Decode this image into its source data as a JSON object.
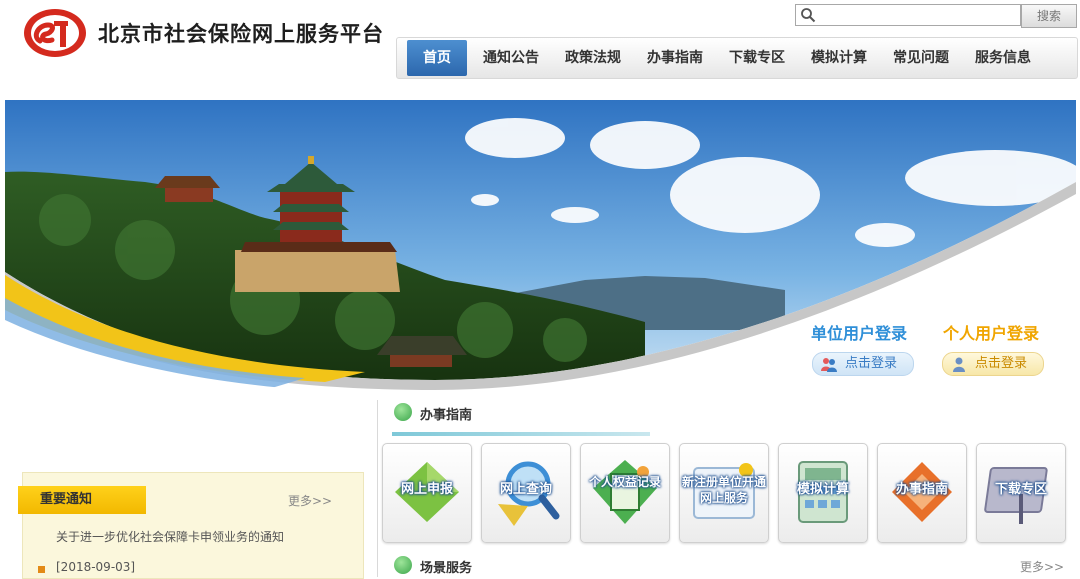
{
  "header": {
    "site_title": "北京市社会保险网上服务平台",
    "search": {
      "placeholder": "",
      "button_label": "搜索"
    }
  },
  "nav": {
    "items": [
      {
        "label": "首页",
        "active": true
      },
      {
        "label": "通知公告"
      },
      {
        "label": "政策法规"
      },
      {
        "label": "办事指南"
      },
      {
        "label": "下载专区"
      },
      {
        "label": "模拟计算"
      },
      {
        "label": "常见问题"
      },
      {
        "label": "服务信息"
      }
    ]
  },
  "banner": {
    "unit_login": {
      "title": "单位用户登录",
      "button_label": "点击登录"
    },
    "person_login": {
      "title": "个人用户登录",
      "button_label": "点击登录"
    }
  },
  "notice": {
    "tab_label": "重要通知",
    "more_label": "更多>>",
    "items": [
      {
        "title": "关于进一步优化社会保障卡申领业务的通知",
        "date": "[2018-09-03]"
      }
    ]
  },
  "guide": {
    "title": "办事指南",
    "tiles": [
      {
        "label": "网上申报",
        "icon": "declare-icon",
        "color": "#7cc242"
      },
      {
        "label": "网上查询",
        "icon": "magnifier-icon",
        "color": "#3d8fd6"
      },
      {
        "label": "个人权益记录",
        "icon": "record-icon",
        "color": "#4caf50"
      },
      {
        "label": "新注册单位开通网上服务",
        "icon": "register-icon",
        "color": "#2b7fd1"
      },
      {
        "label": "模拟计算",
        "icon": "calculator-icon",
        "color": "#6fa8d8"
      },
      {
        "label": "办事指南",
        "icon": "guide-icon",
        "color": "#e8702a"
      },
      {
        "label": "下载专区",
        "icon": "download-icon",
        "color": "#8a8aa8"
      }
    ]
  },
  "scene": {
    "title": "场景服务",
    "more_label": "更多>>"
  },
  "colors": {
    "nav_active": "#2c67ad",
    "logo_red": "#d42a1e",
    "notice_tab": "#f2b800",
    "banner_sky": "#3f86d0"
  }
}
